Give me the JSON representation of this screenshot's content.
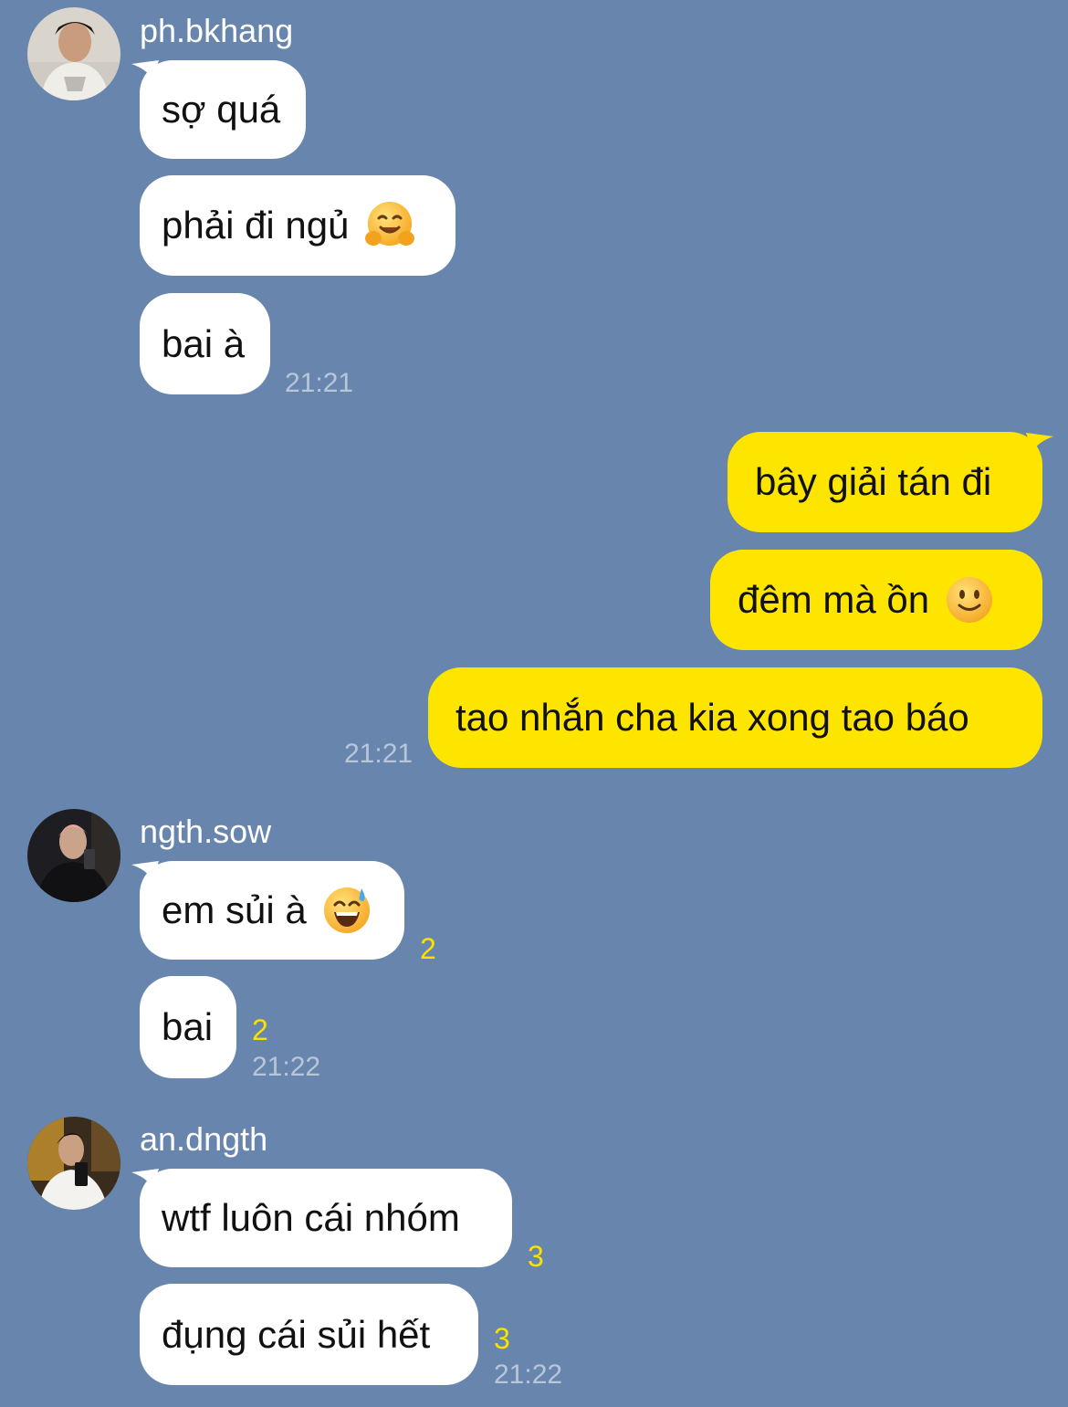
{
  "chat": {
    "groups": [
      {
        "sender": "ph.bkhang",
        "messages": [
          "sợ quá",
          "phải đi ngủ",
          "bai à"
        ],
        "time": "21:21"
      },
      {
        "sender": "ngth.sow",
        "messages": [
          "em sủi à",
          "bai"
        ],
        "unread": [
          "2",
          "2"
        ],
        "time": "21:22"
      },
      {
        "sender": "an.dngth",
        "messages": [
          "wtf luôn cái nhóm",
          "đụng cái sủi hết"
        ],
        "unread": [
          "3",
          "3"
        ],
        "time": "21:22"
      }
    ],
    "outgoing": {
      "messages": [
        "bây giải tán đi",
        "đêm mà ồn",
        "tao nhắn cha kia xong tao báo"
      ],
      "time": "21:21"
    }
  },
  "emojis": {
    "hug": "hugging-face-emoji",
    "smile": "slightly-smiling-face-emoji",
    "sweat": "grinning-face-with-sweat-emoji"
  },
  "colors": {
    "background": "#6886ad",
    "incoming_bubble": "#ffffff",
    "outgoing_bubble": "#fee500",
    "unread_count": "#f9e100",
    "timestamp": "#b8c6da"
  }
}
